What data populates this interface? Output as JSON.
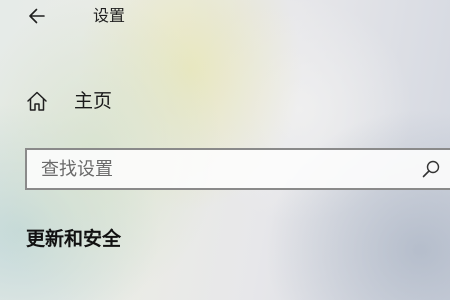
{
  "window": {
    "title": "设置"
  },
  "nav": {
    "home": {
      "label": "主页",
      "icon": "home-icon"
    }
  },
  "search": {
    "placeholder": "查找设置",
    "value": "",
    "icon": "search-icon"
  },
  "section": {
    "heading": "更新和安全"
  },
  "colors": {
    "text": "#1a1a1a",
    "search_border": "#8a8a8a",
    "search_background": "#fcfcfc"
  }
}
